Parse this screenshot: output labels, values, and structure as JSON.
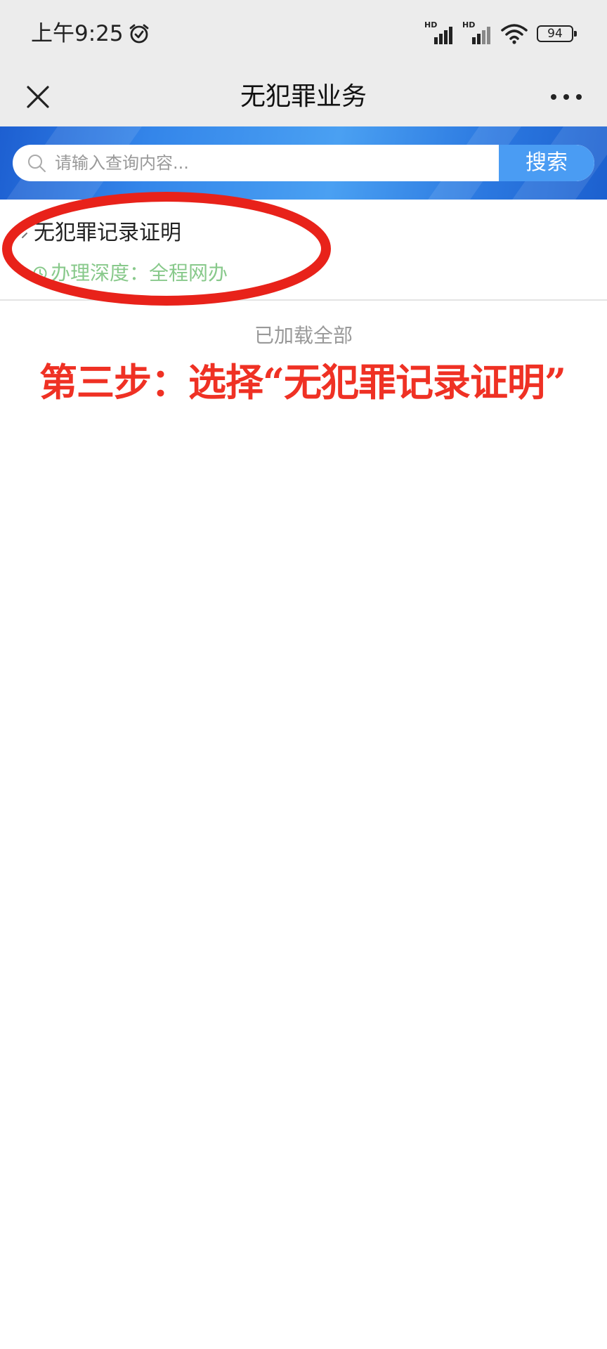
{
  "status_bar": {
    "time": "上午9:25",
    "signal_1_label": "HD",
    "signal_2_label": "HD",
    "battery": "94"
  },
  "nav": {
    "title": "无犯罪业务"
  },
  "search": {
    "placeholder": "请输入查询内容...",
    "button_label": "搜索"
  },
  "results": [
    {
      "title": "无犯罪记录证明",
      "depth_label": "办理深度：全程网办"
    }
  ],
  "list_footer": "已加载全部",
  "annotation": {
    "caption": "第三步：选择“无犯罪记录证明”",
    "highlight_color": "#e8221a"
  },
  "colors": {
    "accent_blue": "#4a9cf3",
    "depth_green": "#88c98b",
    "caption_red": "#ef3124"
  }
}
